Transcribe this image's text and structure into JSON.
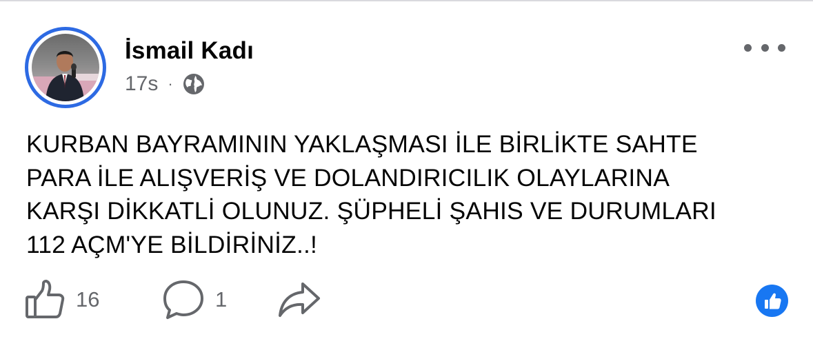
{
  "post": {
    "author": "İsmail Kadı",
    "timestamp": "17s",
    "separator": "·",
    "audience_icon": "globe-icon",
    "more_icon": "more-options-icon",
    "text": "KURBAN BAYRAMININ YAKLAŞMASI İLE BİRLİKTE SAHTE\nPARA İLE ALIŞVERİŞ VE DOLANDIRICILIK OLAYLARINA\nKARŞI DİKKATLİ OLUNUZ. ŞÜPHELİ ŞAHIS VE DURUMLARI\n112 AÇM'YE BİLDİRİNİZ..!"
  },
  "actions": {
    "like_icon": "thumbs-up-icon",
    "like_count": "16",
    "comment_icon": "comment-icon",
    "comment_count": "1",
    "share_icon": "share-icon"
  },
  "reaction": {
    "icon": "like-reaction-icon",
    "color": "#1877f2"
  },
  "colors": {
    "story_ring": "#2d6ae3",
    "secondary_text": "#65676b"
  }
}
